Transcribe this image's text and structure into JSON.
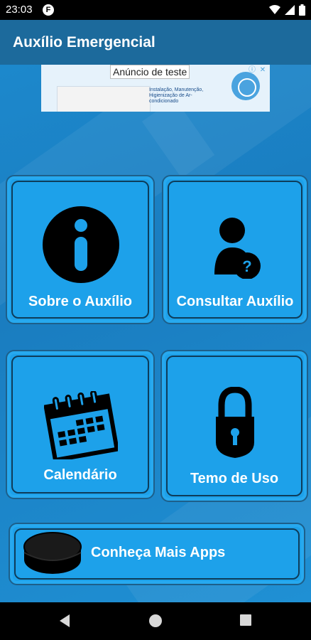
{
  "status": {
    "time": "23:03",
    "notification_badge": "F"
  },
  "app_bar": {
    "title": "Auxílio Emergencial"
  },
  "ad": {
    "badge": "Anúncio de teste",
    "text": "Instalação, Manutenção, Higienização de Ar-condicionado",
    "info_icon": "info-icon",
    "close_icon": "close-icon"
  },
  "cards": {
    "sobre": {
      "label": "Sobre o Auxílio",
      "icon": "info-circle-icon"
    },
    "consultar": {
      "label": "Consultar Auxílio",
      "icon": "user-question-icon"
    },
    "calendario": {
      "label": "Calendário",
      "icon": "calendar-icon"
    },
    "termo": {
      "label": "Temo de Uso",
      "icon": "lock-icon"
    },
    "apps": {
      "label": "Conheça Mais Apps",
      "icon": "puck-icon"
    }
  },
  "colors": {
    "app_bar": "#1c6a9c",
    "background": "#1a7dc0",
    "card": "#1da1ea",
    "card_border": "#0e3c5a"
  }
}
